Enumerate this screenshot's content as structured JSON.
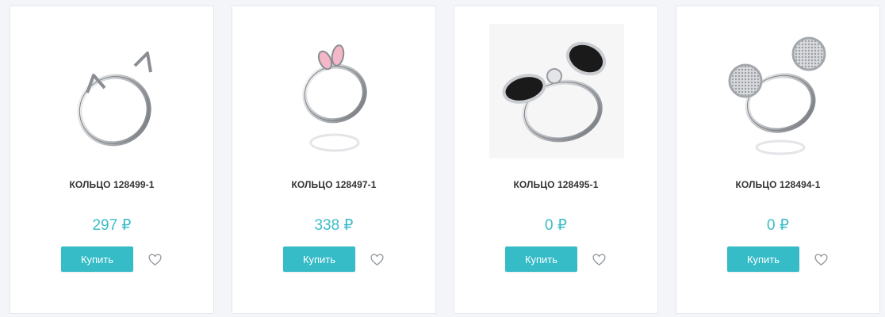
{
  "products": [
    {
      "title": "КОЛЬЦО 128499-1",
      "price": "297 ₽",
      "buy_label": "Купить",
      "image": "cat-ear-ring"
    },
    {
      "title": "КОЛЬЦО 128497-1",
      "price": "338 ₽",
      "buy_label": "Купить",
      "image": "bunny-ear-ring"
    },
    {
      "title": "КОЛЬЦО 128495-1",
      "price": "0 ₽",
      "buy_label": "Купить",
      "image": "bow-ring"
    },
    {
      "title": "КОЛЬЦО 128494-1",
      "price": "0 ₽",
      "buy_label": "Купить",
      "image": "mouse-ear-ring"
    }
  ],
  "colors": {
    "accent": "#35bcc7",
    "price": "#3cbcc8",
    "title": "#333333",
    "page_bg": "#f4f5f9"
  },
  "icons": {
    "wishlist": "heart-outline-icon"
  }
}
